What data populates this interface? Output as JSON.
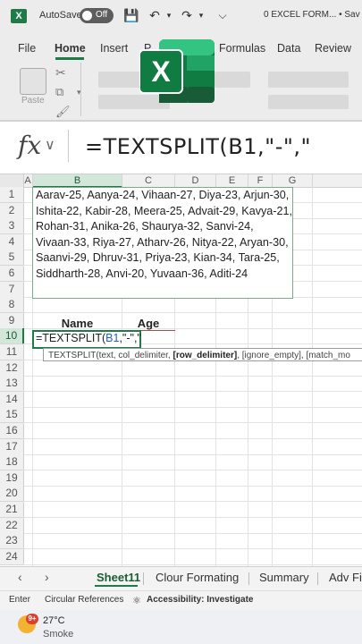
{
  "titlebar": {
    "autosave_label": "AutoSave",
    "autosave_state": "Off",
    "doc_title": "0 EXCEL FORM... • Sav"
  },
  "ribbon": {
    "tabs": [
      "File",
      "Home",
      "Insert",
      "P",
      "Formulas",
      "Data",
      "Review"
    ],
    "active_tab": "Home",
    "paste_label": "Paste"
  },
  "formula_bar": {
    "fx": "fx",
    "formula": "=TEXTSPLIT(B1,\"-\",\""
  },
  "grid": {
    "columns": [
      "A",
      "B",
      "C",
      "D",
      "E",
      "F",
      "G"
    ],
    "rows": [
      "1",
      "2",
      "3",
      "4",
      "5",
      "6",
      "7",
      "8",
      "9",
      "10",
      "11",
      "12",
      "13",
      "14",
      "15",
      "16",
      "17",
      "18",
      "19",
      "20",
      "21",
      "22",
      "23",
      "24"
    ],
    "b1_text": "Aarav-25, Aanya-24, Vihaan-27, Diya-23, Arjun-30, Ishita-22, Kabir-28, Meera-25, Advait-29, Kavya-21, Rohan-31, Anika-26, Shaurya-32, Sanvi-24, Vivaan-33, Riya-27, Atharv-26, Nitya-22, Aryan-30, Saanvi-29, Dhruv-31, Priya-23, Kian-34, Tara-25, Siddharth-28, Anvi-20, Yuvaan-36, Aditi-24",
    "header_name": "Name",
    "header_age": "Age",
    "active_prefix": "=TEXTSPLIT(",
    "active_ref": "B1",
    "active_suffix": ",\"-\",\"",
    "tooltip": "TEXTSPLIT(text, col_delimiter, [row_delimiter], [ignore_empty], [match_mo"
  },
  "sheet_tabs": [
    "Sheet11",
    "Clour Formating",
    "Summary",
    "Adv Fil"
  ],
  "active_sheet": "Sheet11",
  "status": {
    "mode": "Enter",
    "circular": "Circular References",
    "accessibility": "Accessibility: Investigate"
  },
  "taskbar": {
    "badge": "9+",
    "temperature": "27°C",
    "condition": "Smoke"
  },
  "colors": {
    "excel_green": "#1f7a46",
    "ref_blue": "#1f5fbf"
  }
}
